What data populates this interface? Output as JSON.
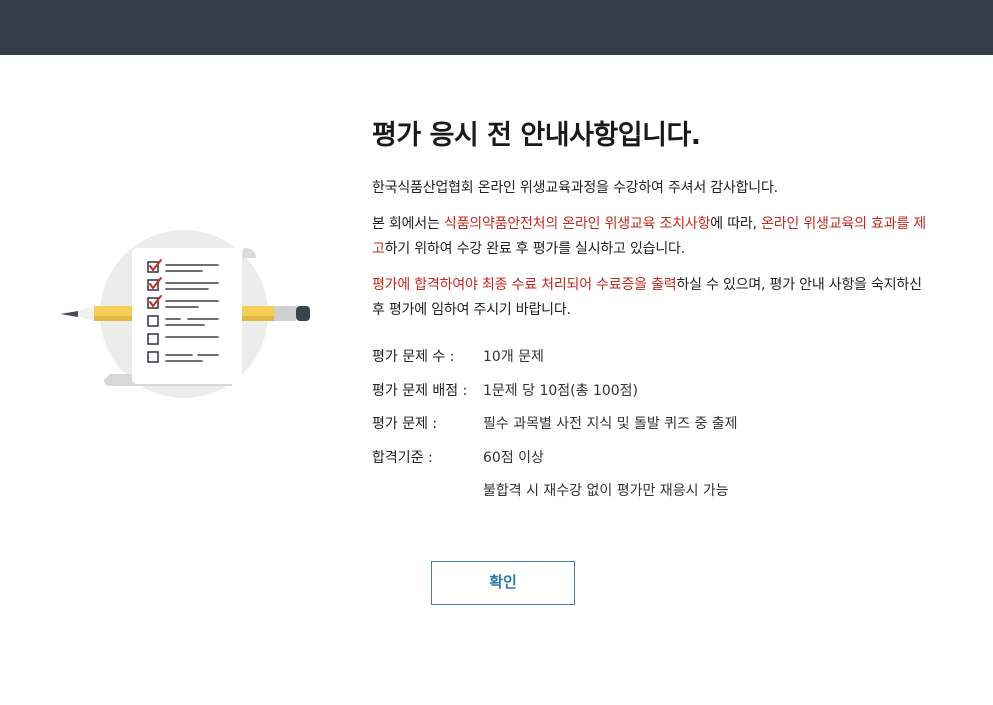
{
  "header": {},
  "notice": {
    "title": "평가 응시 전 안내사항입니다.",
    "p1": "한국식품산업협회 온라인 위생교육과정을 수강하여 주셔서 감사합니다.",
    "p2": {
      "a": "본 회에서는 ",
      "b": "식품의약품안전처의 온라인 위생교육 조치사항",
      "c": "에 따라, ",
      "d": "온라인 위생교육의 효과를 제고",
      "e": "하기 위하여 수강 완료 후 평가를 실시하고 있습니다."
    },
    "p3": {
      "a": "평가에 합격하여야 최종 수료 처리되어 수료증을 출력",
      "b": "하실 수 있으며, 평가 안내 사항을 숙지하신 후 평가에 임하여 주시기 바랍니다."
    },
    "accent_color": "#c8281e"
  },
  "info": [
    {
      "label": "평가 문제 수 :",
      "value": "10개 문제"
    },
    {
      "label": "평가 문제 배점 :",
      "value": "1문제 당 10점(총 100점)"
    },
    {
      "label": "평가 문제 :",
      "value": "필수 과목별 사전 지식 및 돌발 퀴즈 중 출제"
    },
    {
      "label": "합격기준 :",
      "value": "60점 이상"
    },
    {
      "label": "",
      "value": "불합격 시 재수강 없이 평가만 재응시 가능"
    }
  ],
  "confirm_button": {
    "label": "확인"
  },
  "illustration": {
    "icon": "checklist-pencil-icon",
    "checked_items": 3,
    "total_items": 6
  }
}
